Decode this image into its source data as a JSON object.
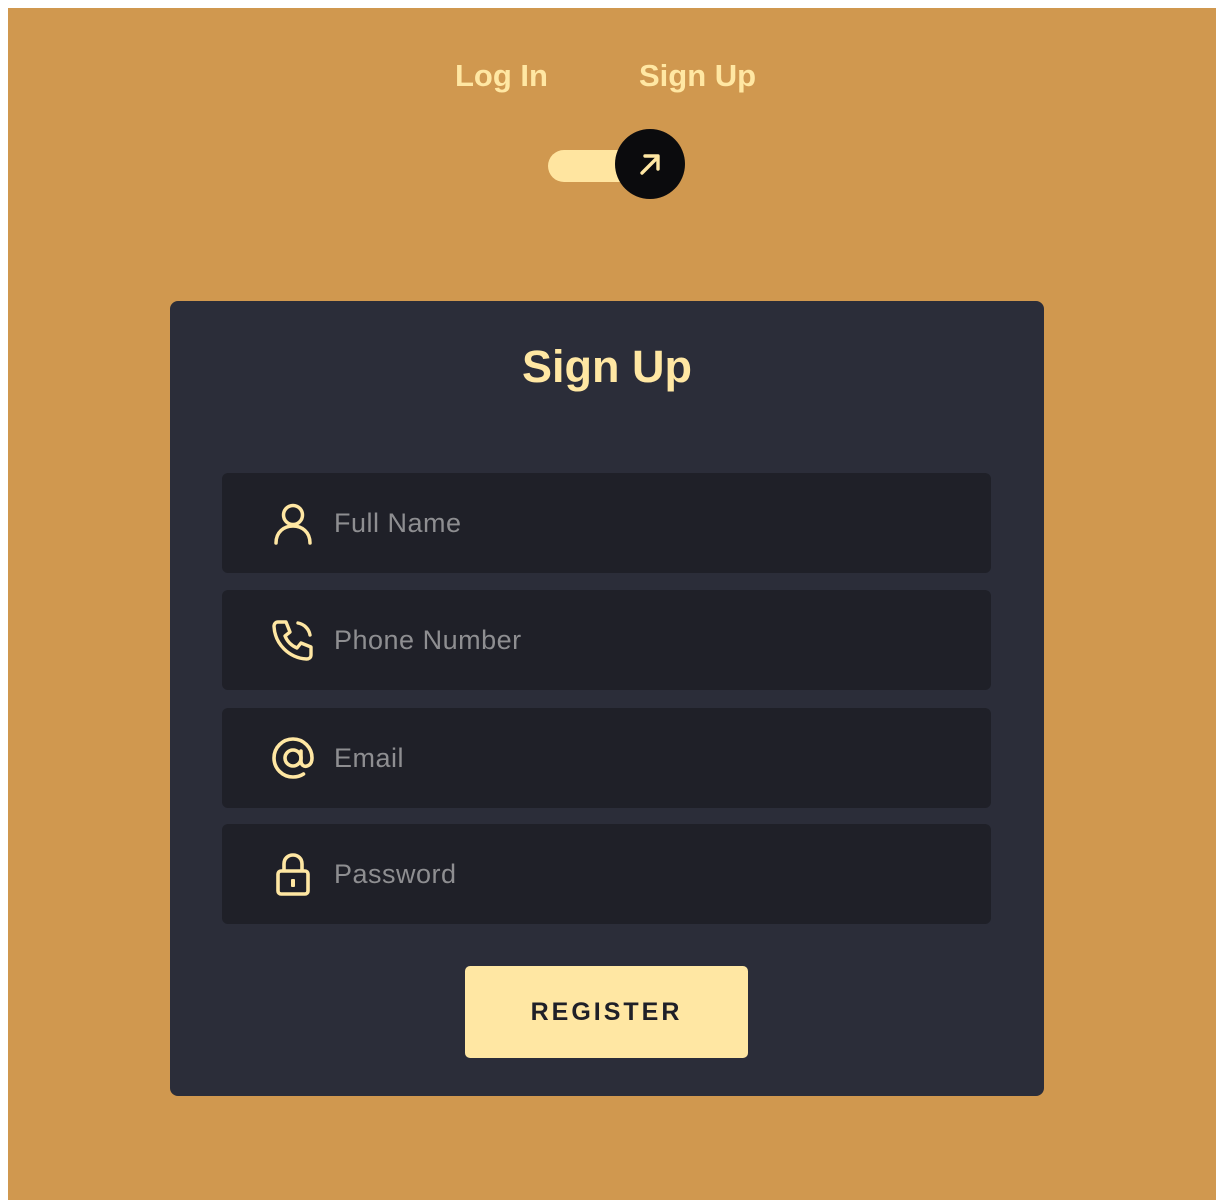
{
  "colors": {
    "page_background": "#d0984f",
    "accent": "#ffe7a3",
    "card_background": "#2b2d39",
    "field_background": "#1f2028",
    "toggle_knob": "#0b0b0d",
    "placeholder_text": "#8e8e91"
  },
  "mode_switch": {
    "login_label": "Log In",
    "signup_label": "Sign Up",
    "selected": "Sign Up",
    "knob_icon": "arrow-up-right-icon"
  },
  "card": {
    "title": "Sign Up",
    "fields": [
      {
        "icon": "user-icon",
        "placeholder": "Full Name",
        "value": ""
      },
      {
        "icon": "phone-icon",
        "placeholder": "Phone Number",
        "value": ""
      },
      {
        "icon": "at-sign-icon",
        "placeholder": "Email",
        "value": ""
      },
      {
        "icon": "lock-icon",
        "placeholder": "Password",
        "value": ""
      }
    ],
    "submit_label": "REGISTER"
  }
}
